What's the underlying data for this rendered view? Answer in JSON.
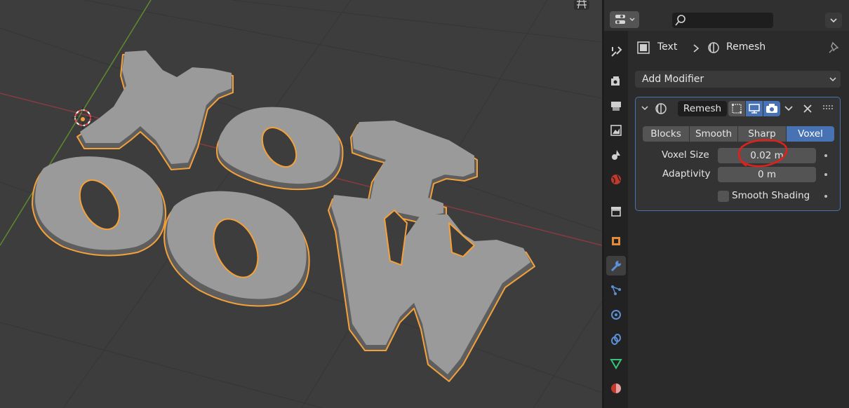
{
  "viewport": {
    "letters": [
      "N",
      "O",
      "T",
      "O",
      "O",
      "W"
    ],
    "outline_color": "#f5a13a"
  },
  "header": {
    "search_placeholder": ""
  },
  "breadcrumb": {
    "object_name": "Text",
    "modifier_name": "Remesh"
  },
  "add_modifier": {
    "label": "Add Modifier"
  },
  "modifier": {
    "name": "Remesh",
    "modes": [
      "Blocks",
      "Smooth",
      "Sharp",
      "Voxel"
    ],
    "active_mode": "Voxel",
    "voxel_size_label": "Voxel Size",
    "voxel_size_value": "0.02 m",
    "adaptivity_label": "Adaptivity",
    "adaptivity_value": "0 m",
    "smooth_shading_label": "Smooth Shading",
    "smooth_shading_checked": false
  },
  "annotation": {
    "color": "#e0201c"
  },
  "colors": {
    "accent": "#4772b3",
    "selection": "#f5a13a"
  },
  "icons": [
    "tool-icon",
    "render-icon",
    "output-icon",
    "view-layer-icon",
    "scene-icon",
    "world-icon",
    "collection-icon",
    "object-icon",
    "modifier-icon",
    "particles-icon",
    "physics-icon",
    "constraints-icon",
    "data-icon",
    "material-icon"
  ]
}
